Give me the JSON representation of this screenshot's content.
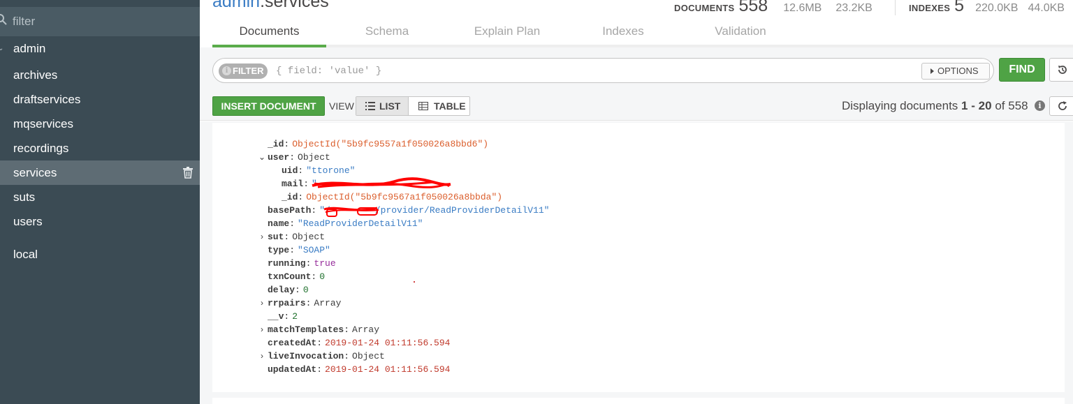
{
  "sidebar": {
    "filter_placeholder": "filter",
    "databases": [
      {
        "label": "admin",
        "collections": [
          "archives",
          "draftservices",
          "mqservices",
          "recordings",
          "services",
          "suts",
          "users"
        ]
      },
      {
        "label": "local"
      }
    ],
    "active_collection": "services"
  },
  "header": {
    "db_name": "admin",
    "collection_name": ".services",
    "documents_label": "DOCUMENTS",
    "documents_count": "558",
    "documents_size": "12.6MB",
    "documents_avg": "23.2KB",
    "indexes_label": "INDEXES",
    "indexes_count": "5",
    "indexes_size": "220.0KB",
    "indexes_avg": "44.0KB"
  },
  "tabs": [
    "Documents",
    "Schema",
    "Explain Plan",
    "Indexes",
    "Validation"
  ],
  "active_tab": "Documents",
  "query": {
    "filter_badge": "FILTER",
    "filter_placeholder": "{ field: 'value' }",
    "options_label": "OPTIONS",
    "find_label": "FIND"
  },
  "toolbar": {
    "insert_label": "INSERT DOCUMENT",
    "view_label": "VIEW",
    "list_label": "LIST",
    "table_label": "TABLE",
    "display_prefix": "Displaying documents",
    "display_from": "1",
    "display_sep": "-",
    "display_to": "20",
    "display_of": "of",
    "display_total": "558"
  },
  "document": {
    "fields": [
      {
        "key": "_id",
        "value": "ObjectId(\"5b9fc9557a1f050026a8bbd6\")",
        "type": "oid"
      },
      {
        "key": "user",
        "value": "Object",
        "type": "plain",
        "expanded": true
      },
      {
        "key": "uid",
        "value": "\"ttorone\"",
        "type": "str"
      },
      {
        "key": "mail",
        "value": "\"",
        "type": "str"
      },
      {
        "key": "_id",
        "value": "ObjectId(\"5b9fc9567a1f050026a8bbda\")",
        "type": "oid"
      },
      {
        "key": "basePath",
        "value": "\"/",
        "value2": "/provider/ReadProviderDetailV11\"",
        "type": "str"
      },
      {
        "key": "name",
        "value": "\"ReadProviderDetailV11\"",
        "type": "str"
      },
      {
        "key": "sut",
        "value": "Object",
        "type": "plain",
        "expanded": false
      },
      {
        "key": "type",
        "value": "\"SOAP\"",
        "type": "str"
      },
      {
        "key": "running",
        "value": "true",
        "type": "bool"
      },
      {
        "key": "txnCount",
        "value": "0",
        "type": "num"
      },
      {
        "key": "delay",
        "value": "0",
        "type": "num"
      },
      {
        "key": "rrpairs",
        "value": "Array",
        "type": "plain",
        "expanded": false
      },
      {
        "key": "__v",
        "value": "2",
        "type": "num"
      },
      {
        "key": "matchTemplates",
        "value": "Array",
        "type": "plain",
        "expanded": false
      },
      {
        "key": "createdAt",
        "value": "2019-01-24 01:11:56.594",
        "type": "date"
      },
      {
        "key": "liveInvocation",
        "value": "Object",
        "type": "plain",
        "expanded": false
      },
      {
        "key": "updatedAt",
        "value": "2019-01-24 01:11:56.594",
        "type": "date"
      }
    ]
  },
  "colors": {
    "sidebar_bg": "#3b4b54",
    "accent_green": "#4fa345",
    "oid": "#db5e2c",
    "string": "#3a7cc4",
    "date": "#c0392b",
    "bool": "#962d9b",
    "number": "#1d6f2b",
    "redaction": "#ff0000"
  },
  "icons": {
    "search": "search-icon",
    "trash": "trash-icon",
    "reset": "history-icon",
    "refresh": "refresh-icon",
    "info": "info-icon",
    "list": "list-icon",
    "table": "table-icon"
  }
}
